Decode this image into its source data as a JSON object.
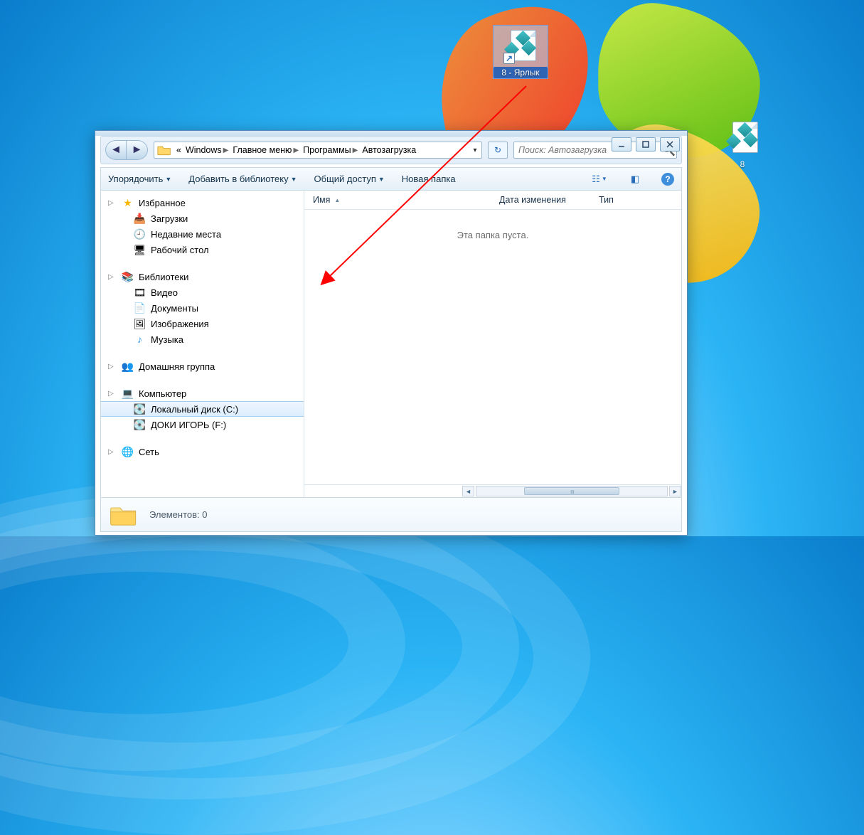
{
  "desktop": {
    "shortcut": {
      "label": "8 - Ярлык"
    },
    "app": {
      "label": "8"
    }
  },
  "window": {
    "breadcrumbs": [
      "Windows",
      "Главное меню",
      "Программы",
      "Автозагрузка"
    ],
    "breadcrumb_prefix": "«",
    "search_placeholder": "Поиск: Автозагрузка",
    "toolbar": {
      "organize": "Упорядочить",
      "add_lib": "Добавить в библиотеку",
      "share": "Общий доступ",
      "new_folder": "Новая папка"
    },
    "sidebar": {
      "favorites": {
        "title": "Избранное",
        "items": [
          "Загрузки",
          "Недавние места",
          "Рабочий стол"
        ]
      },
      "libraries": {
        "title": "Библиотеки",
        "items": [
          "Видео",
          "Документы",
          "Изображения",
          "Музыка"
        ]
      },
      "homegroup": "Домашняя группа",
      "computer": {
        "title": "Компьютер",
        "items": [
          "Локальный диск (C:)",
          "ДОКИ ИГОРЬ (F:)"
        ]
      },
      "network": "Сеть"
    },
    "columns": {
      "name": "Имя",
      "date": "Дата изменения",
      "type": "Тип"
    },
    "empty_text": "Эта папка пуста.",
    "status": {
      "label": "Элементов:",
      "count": "0"
    }
  }
}
